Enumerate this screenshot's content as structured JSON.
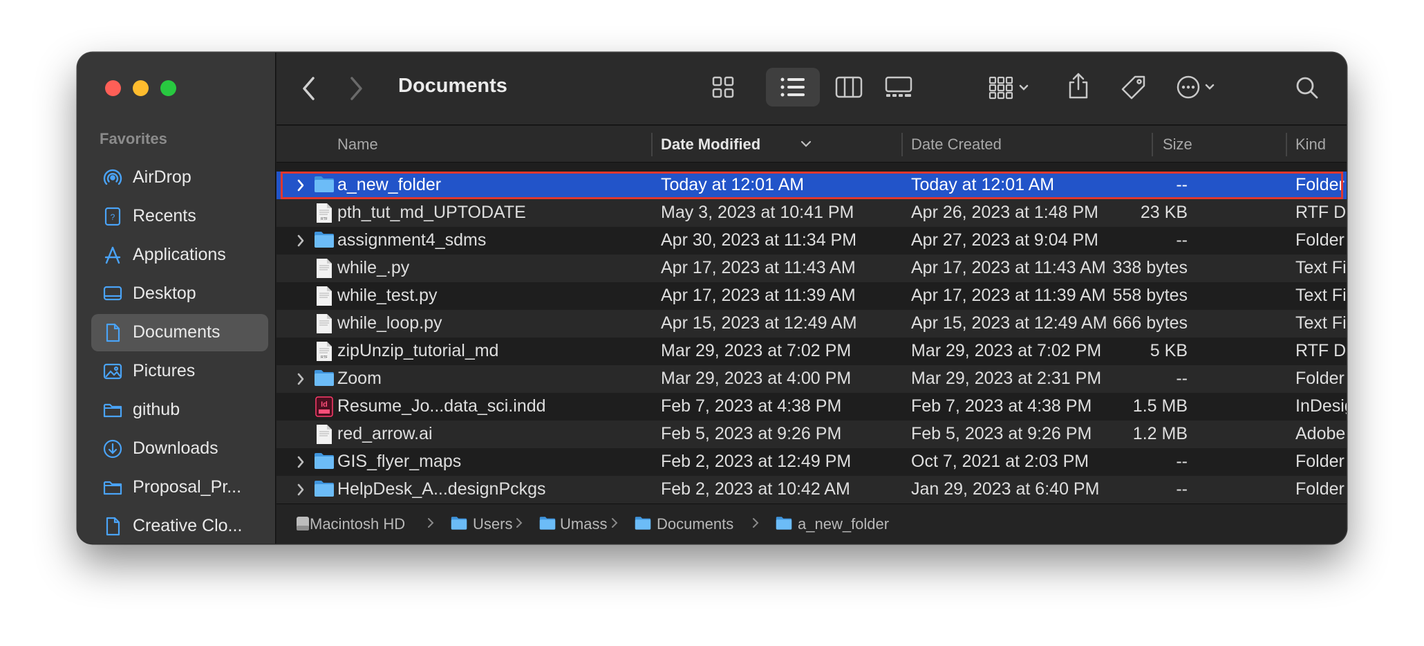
{
  "window": {
    "title": "Documents"
  },
  "sidebar": {
    "section_title": "Favorites",
    "items": [
      {
        "label": "AirDrop",
        "icon": "airdrop-icon",
        "active": false
      },
      {
        "label": "Recents",
        "icon": "recents-icon",
        "active": false
      },
      {
        "label": "Applications",
        "icon": "applications-icon",
        "active": false
      },
      {
        "label": "Desktop",
        "icon": "desktop-icon",
        "active": false
      },
      {
        "label": "Documents",
        "icon": "document-icon",
        "active": true
      },
      {
        "label": "Pictures",
        "icon": "pictures-icon",
        "active": false
      },
      {
        "label": "github",
        "icon": "folder-icon",
        "active": false
      },
      {
        "label": "Downloads",
        "icon": "downloads-icon",
        "active": false
      },
      {
        "label": "Proposal_Pr...",
        "icon": "folder-icon",
        "active": false
      },
      {
        "label": "Creative Clo...",
        "icon": "document-icon",
        "active": false
      }
    ]
  },
  "toolbar": {
    "back": "back-icon",
    "forward": "forward-icon",
    "view_modes": [
      "icon-view-icon",
      "list-view-icon",
      "column-view-icon",
      "gallery-view-icon"
    ],
    "active_view": "list",
    "actions": [
      "group-icon",
      "share-icon",
      "tag-icon",
      "more-icon",
      "search-icon"
    ]
  },
  "columns": {
    "name": "Name",
    "date_modified": "Date Modified",
    "date_created": "Date Created",
    "size": "Size",
    "kind": "Kind"
  },
  "files": [
    {
      "name": "a_new_folder",
      "modified": "Today at 12:01 AM",
      "created": "Today at 12:01 AM",
      "size": "--",
      "kind": "Folder",
      "type": "folder",
      "selected": true
    },
    {
      "name": "pth_tut_md_UPTODATE",
      "modified": "May 3, 2023 at 10:41 PM",
      "created": "Apr 26, 2023 at 1:48 PM",
      "size": "23 KB",
      "kind": "RTF Document",
      "type": "rtf"
    },
    {
      "name": "assignment4_sdms",
      "modified": "Apr 30, 2023 at 11:34 PM",
      "created": "Apr 27, 2023 at 9:04 PM",
      "size": "--",
      "kind": "Folder",
      "type": "folder"
    },
    {
      "name": "while_.py",
      "modified": "Apr 17, 2023 at 11:43 AM",
      "created": "Apr 17, 2023 at 11:43 AM",
      "size": "338 bytes",
      "kind": "Text File",
      "type": "text"
    },
    {
      "name": "while_test.py",
      "modified": "Apr 17, 2023 at 11:39 AM",
      "created": "Apr 17, 2023 at 11:39 AM",
      "size": "558 bytes",
      "kind": "Text File",
      "type": "text"
    },
    {
      "name": "while_loop.py",
      "modified": "Apr 15, 2023 at 12:49 AM",
      "created": "Apr 15, 2023 at 12:49 AM",
      "size": "666 bytes",
      "kind": "Text File",
      "type": "text"
    },
    {
      "name": "zipUnzip_tutorial_md",
      "modified": "Mar 29, 2023 at 7:02 PM",
      "created": "Mar 29, 2023 at 7:02 PM",
      "size": "5 KB",
      "kind": "RTF Document",
      "type": "rtf"
    },
    {
      "name": "Zoom",
      "modified": "Mar 29, 2023 at 4:00 PM",
      "created": "Mar 29, 2023 at 2:31 PM",
      "size": "--",
      "kind": "Folder",
      "type": "folder"
    },
    {
      "name": "Resume_Jo...data_sci.indd",
      "modified": "Feb 7, 2023 at 4:38 PM",
      "created": "Feb 7, 2023 at 4:38 PM",
      "size": "1.5 MB",
      "kind": "InDesig...ument",
      "type": "indd"
    },
    {
      "name": "red_arrow.ai",
      "modified": "Feb 5, 2023 at 9:26 PM",
      "created": "Feb 5, 2023 at 9:26 PM",
      "size": "1.2 MB",
      "kind": "Adobe...cument",
      "type": "ai"
    },
    {
      "name": "GIS_flyer_maps",
      "modified": "Feb 2, 2023 at 12:49 PM",
      "created": "Oct 7, 2021 at 2:03 PM",
      "size": "--",
      "kind": "Folder",
      "type": "folder"
    },
    {
      "name": "HelpDesk_A...designPckgs",
      "modified": "Feb 2, 2023 at 10:42 AM",
      "created": "Jan 29, 2023 at 6:40 PM",
      "size": "--",
      "kind": "Folder",
      "type": "folder"
    }
  ],
  "path": [
    {
      "label": "Macintosh HD",
      "icon": "hard-drive-icon"
    },
    {
      "label": "Users",
      "icon": "folder-icon"
    },
    {
      "label": "Umass",
      "icon": "home-folder-icon"
    },
    {
      "label": "Documents",
      "icon": "documents-folder-icon"
    },
    {
      "label": "a_new_folder",
      "icon": "folder-icon"
    }
  ],
  "colors": {
    "selection": "#2254c9",
    "highlight_outline": "#e0382e",
    "folder": "#5fb3f5"
  }
}
